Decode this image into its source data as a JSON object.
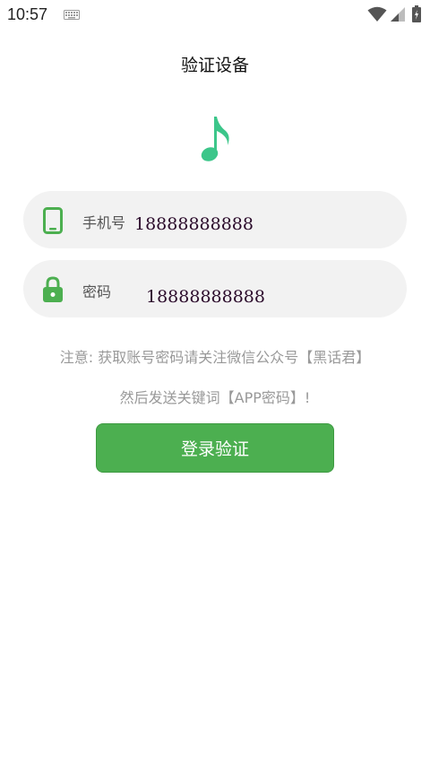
{
  "status_bar": {
    "time": "10:57",
    "icons": [
      "keyboard-icon",
      "wifi-icon",
      "signal-icon",
      "battery-icon"
    ]
  },
  "header": {
    "title": "验证设备"
  },
  "logo": {
    "icon": "music-note-icon",
    "color": "#3cc68a"
  },
  "form": {
    "phone": {
      "label": "手机号",
      "value": "18888888888",
      "icon": "phone-icon"
    },
    "password": {
      "label": "密码",
      "value": "18888888888",
      "icon": "lock-icon"
    }
  },
  "notice": {
    "line1": "注意: 获取账号密码请关注微信公众号【黑话君】",
    "line2": "然后发送关键词【APP密码】!"
  },
  "actions": {
    "login_label": "登录验证"
  },
  "colors": {
    "accent": "#4caf50",
    "field_bg": "#f2f2f2",
    "value_text": "#2a0a2a"
  }
}
